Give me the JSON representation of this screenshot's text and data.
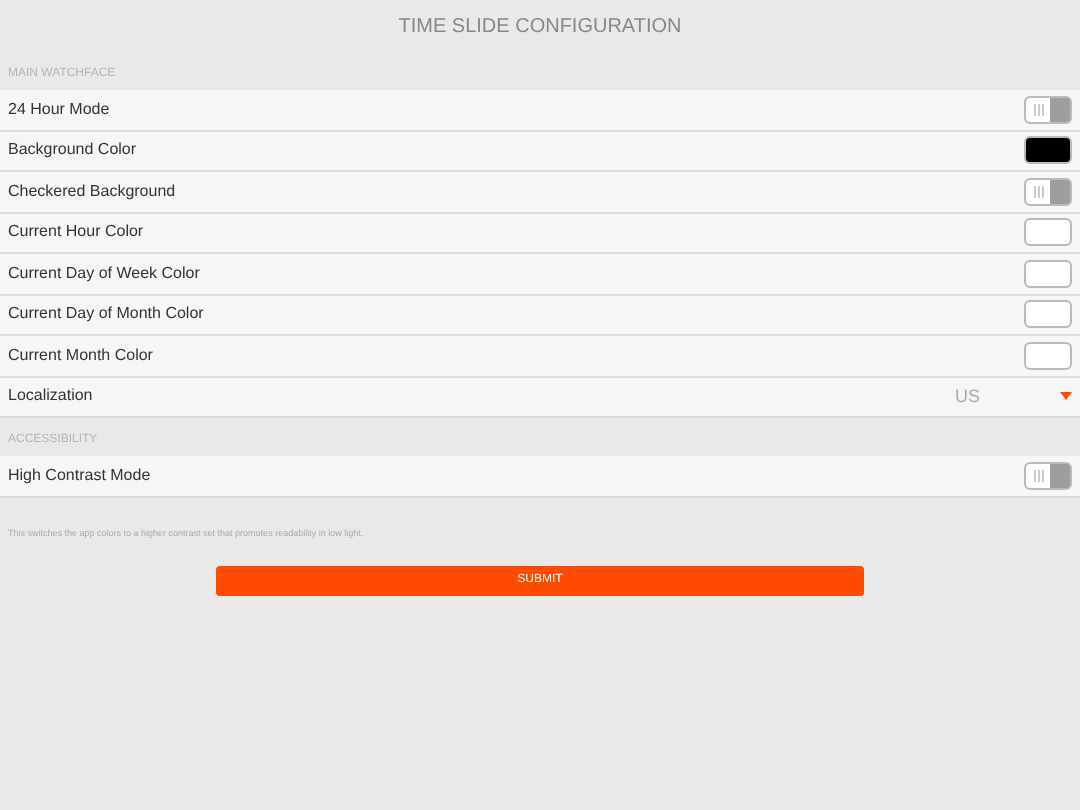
{
  "title": "TIME SLIDE CONFIGURATION",
  "sections": [
    {
      "heading": "MAIN WATCHFACE",
      "rows": [
        {
          "kind": "toggle",
          "label": "24 Hour Mode",
          "on": false
        },
        {
          "kind": "color",
          "label": "Background Color",
          "color": "#000000"
        },
        {
          "kind": "toggle",
          "label": "Checkered Background",
          "on": false
        },
        {
          "kind": "color",
          "label": "Current Hour Color",
          "color": "#ffffff"
        },
        {
          "kind": "color",
          "label": "Current Day of Week Color",
          "color": "#ffffff"
        },
        {
          "kind": "color",
          "label": "Current Day of Month Color",
          "color": "#ffffff"
        },
        {
          "kind": "color",
          "label": "Current Month Color",
          "color": "#ffffff"
        },
        {
          "kind": "select",
          "label": "Localization",
          "value": "US"
        }
      ]
    },
    {
      "heading": "ACCESSIBILITY",
      "rows": [
        {
          "kind": "toggle",
          "label": "High Contrast Mode",
          "on": false
        }
      ],
      "note": "This switches the app colors to a higher contrast set that promotes readability in low light."
    }
  ],
  "submit": "SUBMIT"
}
